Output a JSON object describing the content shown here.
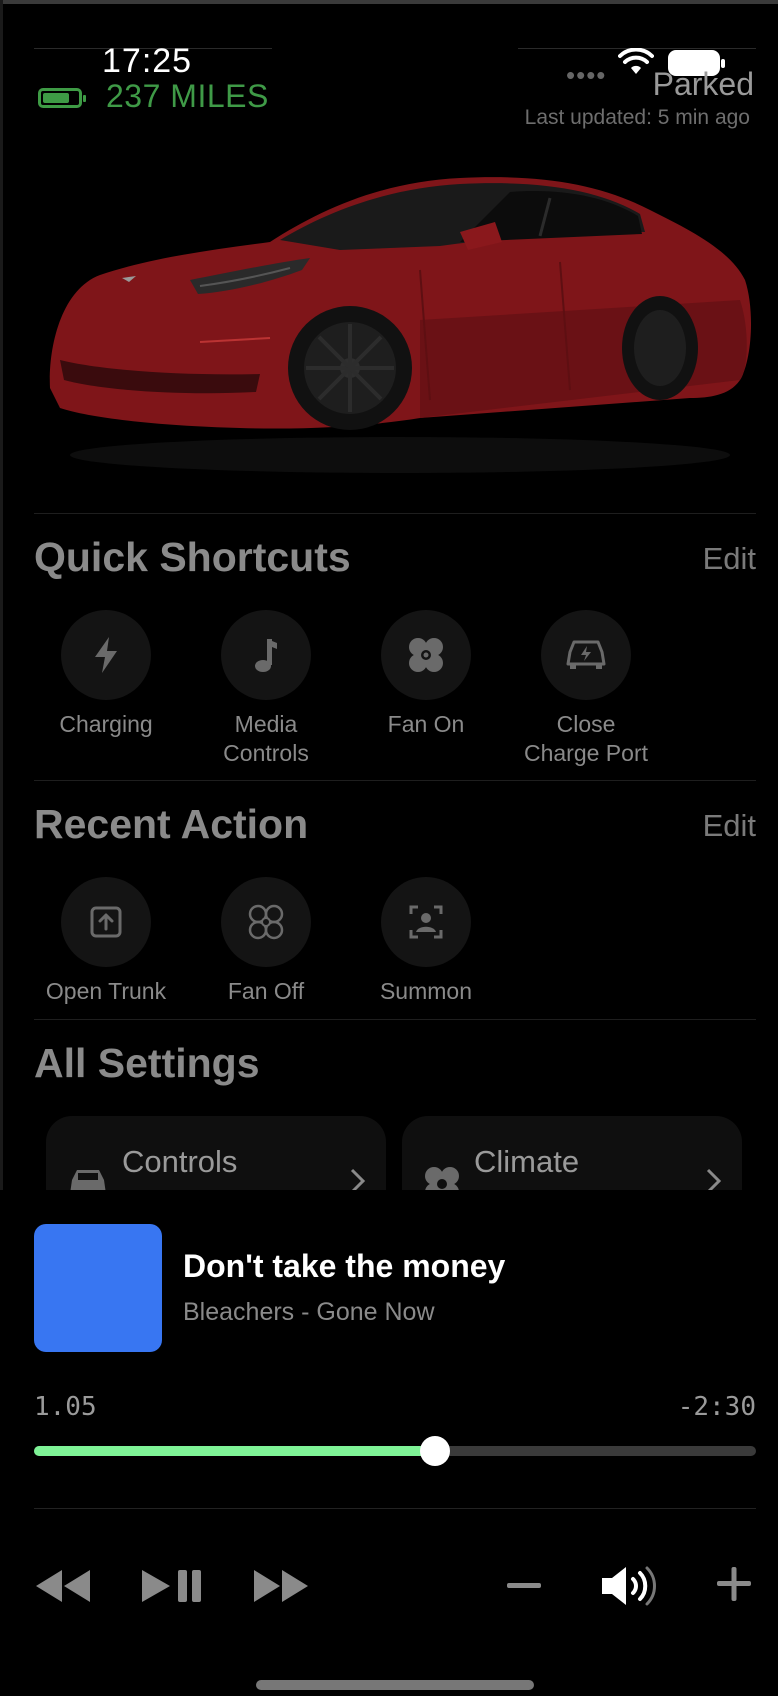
{
  "status_bar": {
    "time": "17:25"
  },
  "vehicle": {
    "range": "237 MILES",
    "state": "Parked",
    "last_updated": "Last updated: 5 min ago"
  },
  "quick_shortcuts": {
    "title": "Quick Shortcuts",
    "edit_label": "Edit",
    "items": [
      {
        "label_line1": "Charging",
        "label_line2": "",
        "icon": "bolt-icon"
      },
      {
        "label_line1": "Media",
        "label_line2": "Controls",
        "icon": "music-note-icon"
      },
      {
        "label_line1": "Fan On",
        "label_line2": "",
        "icon": "fan-icon"
      },
      {
        "label_line1": "Close",
        "label_line2": "Charge Port",
        "icon": "charge-port-icon"
      }
    ]
  },
  "recent_action": {
    "title": "Recent Action",
    "edit_label": "Edit",
    "items": [
      {
        "label": "Open Trunk",
        "icon": "trunk-icon"
      },
      {
        "label": "Fan Off",
        "icon": "fan-outline-icon"
      },
      {
        "label": "Summon",
        "icon": "summon-icon"
      }
    ]
  },
  "all_settings": {
    "title": "All Settings",
    "cards": [
      {
        "label": "Controls",
        "icon": "car-icon"
      },
      {
        "label": "Climate",
        "icon": "fan-icon"
      }
    ]
  },
  "media_player": {
    "track_title": "Don't take the money",
    "track_subtitle": "Bleachers - Gone Now",
    "elapsed": "1.05",
    "remaining": "-2:30",
    "progress": 0.555,
    "album_color": "#3876f2",
    "progress_color": "#7ef296"
  },
  "colors": {
    "range_green": "#3f9a47",
    "car_red": "#8b1a1e"
  }
}
